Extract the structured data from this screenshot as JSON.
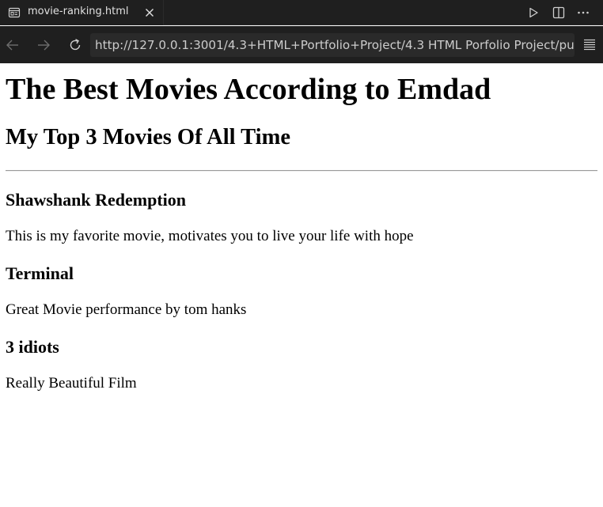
{
  "tab": {
    "title": "movie-ranking.html",
    "icon": "preview-icon",
    "close_icon": "close-icon"
  },
  "tab_actions": [
    "run-icon",
    "split-editor-icon",
    "more-actions-icon"
  ],
  "navigation": {
    "back_icon": "arrow-left-icon",
    "forward_icon": "arrow-right-icon",
    "reload_icon": "reload-icon",
    "url": "http://127.0.0.1:3001/4.3+HTML+Portfolio+Project/4.3 HTML Porfolio Project/publi",
    "menu_icon": "menu-icon"
  },
  "colors": {
    "chrome_bg": "#1f1f1f",
    "url_bg": "#2a2a2a",
    "chrome_text": "#e0e0e0",
    "page_bg": "#ffffff"
  },
  "page": {
    "title": "The Best Movies According to Emdad",
    "subtitle": "My Top 3 Movies Of All Time",
    "movies": [
      {
        "name": "Shawshank Redemption",
        "description": "This is my favorite movie, motivates you to live your life with hope"
      },
      {
        "name": "Terminal",
        "description": "Great Movie performance by tom hanks"
      },
      {
        "name": "3 idiots",
        "description": "Really Beautiful Film"
      }
    ]
  }
}
